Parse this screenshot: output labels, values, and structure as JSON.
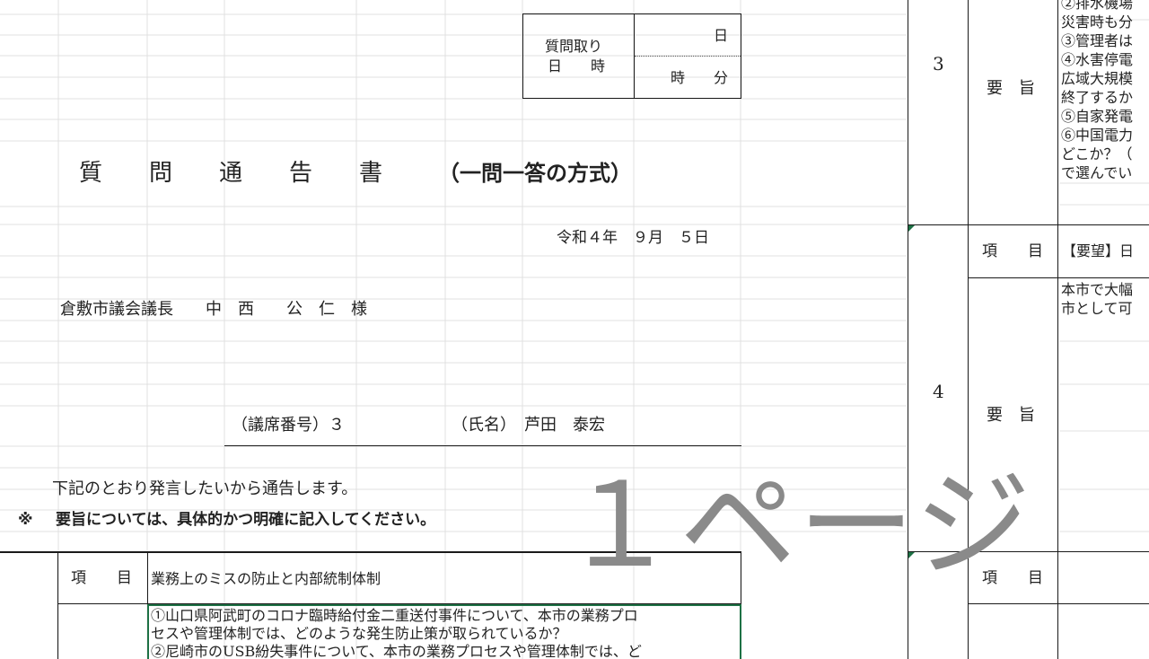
{
  "receipt": {
    "label_line1": "質問取り",
    "label_line2": "日　　時",
    "day_unit": "日",
    "time_units": "時　　分"
  },
  "doc": {
    "title": "質　　問　　通　　告　　書",
    "title_suffix": "（一問一答の方式）",
    "date": "令和４年　９月　５日",
    "addressee": "倉敷市議会議長　　中　西　　公　仁　様",
    "seat_label": "（議席番号）３",
    "name_label": "（氏名）　芦田　泰宏",
    "notice_line1": "下記のとおり発言したいから通告します。",
    "notice_mark": "※",
    "notice_line2": "要旨については、具体的かつ明確に記入してください。"
  },
  "left_table": {
    "item_label": "項　　目",
    "item_value": "業務上のミスの防止と内部統制体制",
    "content_line1": "①山口県阿武町のコロナ臨時給付金二重送付事件について、本市の業務プロ",
    "content_line2": "セスや管理体制では、どのような発生防止策が取られているか？",
    "content_line3": "②尼崎市のUSB紛失事件について、本市の業務プロセスや管理体制では、ど"
  },
  "right_table": {
    "num_3": "3",
    "num_4": "4",
    "summary_label": "要　旨",
    "item_label": "項　　目",
    "r3_lines": [
      "②排水機場",
      "災害時も分",
      "③管理者は",
      "④水害停電",
      "広域大規模",
      "終了するか",
      "⑤自家発電",
      "⑥中国電力",
      "どこか？（",
      "で選んでい"
    ],
    "r4_item_value": "【要望】日",
    "r4_lines": [
      "本市で大幅",
      "市として可"
    ]
  },
  "watermark": "１ページ",
  "colors": {
    "grid": "#e1e1e1",
    "border": "#1a1a1a",
    "selection": "#1e7145",
    "watermark": "#8a8a8a"
  }
}
